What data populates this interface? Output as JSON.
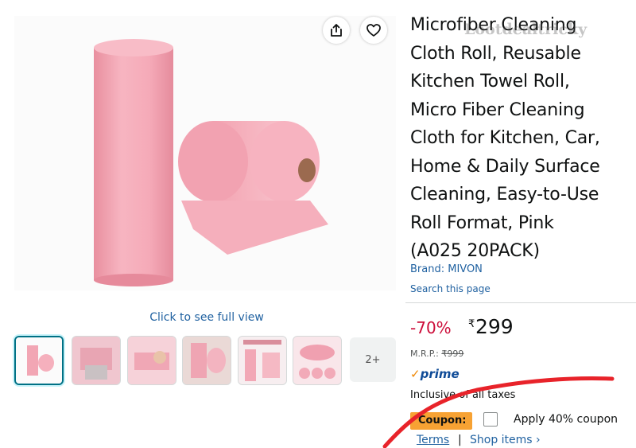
{
  "product": {
    "title_lines": [
      "Microfiber Cleaning",
      "Cloth Roll, Reusable",
      "Kitchen Towel Roll,",
      "Micro Fiber Cleaning",
      "Cloth for Kitchen, Car,",
      "Home & Daily Surface",
      "Cleaning, Easy-to-Use",
      "Roll Format, Pink",
      "(A025 20PACK)"
    ],
    "brand_label": "Brand: MIVON",
    "search_link": "Search this page",
    "image_color": "#f4a9b6"
  },
  "watermark": "Lootdealtricky",
  "gallery": {
    "see_full_view": "Click to see full view",
    "more_count": "2+"
  },
  "price": {
    "discount": "-70%",
    "currency": "₹",
    "amount": "299",
    "mrp_label": "M.R.P.:",
    "mrp_value": "₹999",
    "prime_check": "✓",
    "prime_label": "prime",
    "taxes": "Inclusive of all taxes"
  },
  "coupon": {
    "badge": "Coupon:",
    "apply_text": "Apply 40% coupon"
  },
  "links": {
    "terms": "Terms",
    "separator": "|",
    "shop_items": "Shop items ›"
  },
  "colors": {
    "accent_link": "#2162a1",
    "discount": "#cc0c39",
    "coupon_badge": "#f7a233",
    "annotation": "#e8232a"
  }
}
